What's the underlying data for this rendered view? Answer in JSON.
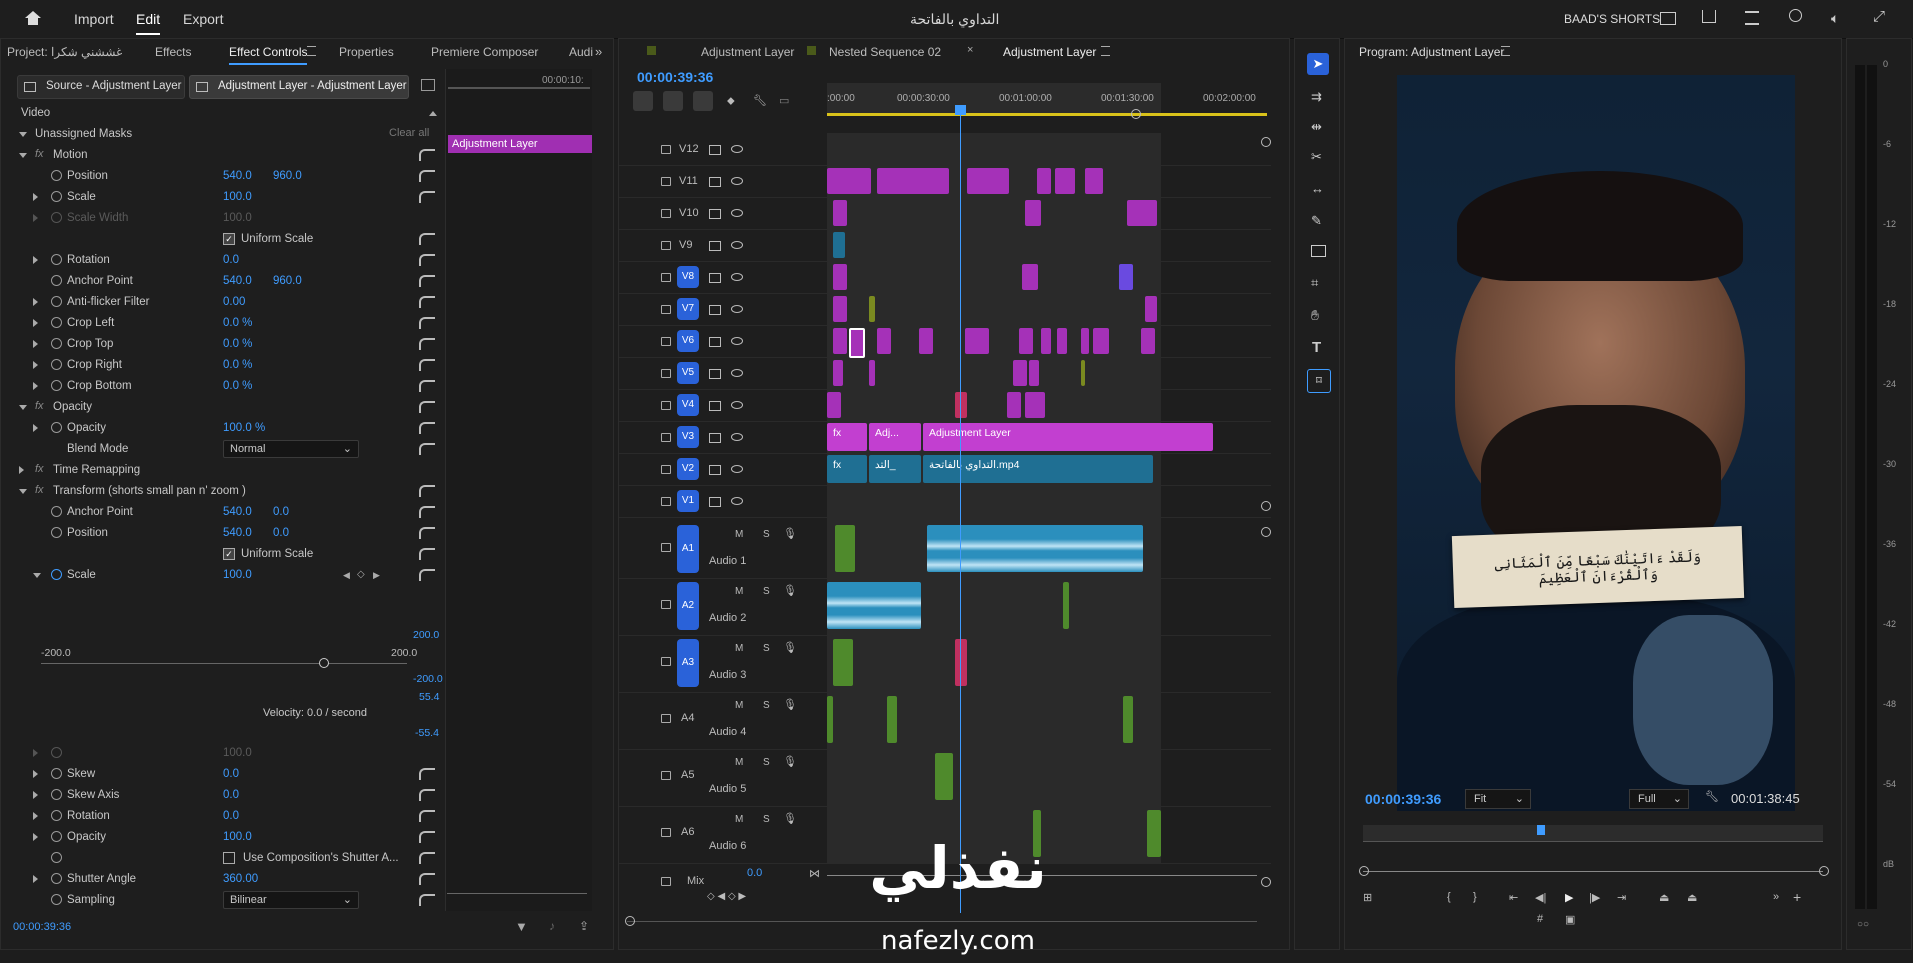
{
  "topbar": {
    "home": "home-icon",
    "menu": [
      "Import",
      "Edit",
      "Export"
    ],
    "title": "التداوي بالفاتحة",
    "workspace": "BAAD'S SHORTS"
  },
  "effect_controls": {
    "tabs": [
      "Project: غششني شكرا",
      "Effects",
      "Effect Controls",
      "Properties",
      "Premiere Composer",
      "Audi"
    ],
    "source": "Source - Adjustment Layer",
    "target": "Adjustment Layer - Adjustment Layer",
    "mini_time": "00:00:10:",
    "mini_clip": "Adjustment Layer",
    "section": "Video",
    "clear_all": "Clear all",
    "unassigned": "Unassigned Masks",
    "rows": {
      "motion": "Motion",
      "position": {
        "label": "Position",
        "v1": "540.0",
        "v2": "960.0"
      },
      "scale": {
        "label": "Scale",
        "v": "100.0"
      },
      "scale_width": {
        "label": "Scale Width",
        "v": "100.0"
      },
      "uniform": "Uniform Scale",
      "rotation": {
        "label": "Rotation",
        "v": "0.0"
      },
      "anchor": {
        "label": "Anchor Point",
        "v1": "540.0",
        "v2": "960.0"
      },
      "antiflicker": {
        "label": "Anti-flicker Filter",
        "v": "0.00"
      },
      "crop_left": {
        "label": "Crop Left",
        "v": "0.0 %"
      },
      "crop_top": {
        "label": "Crop Top",
        "v": "0.0 %"
      },
      "crop_right": {
        "label": "Crop Right",
        "v": "0.0 %"
      },
      "crop_bottom": {
        "label": "Crop Bottom",
        "v": "0.0 %"
      },
      "opacity_group": "Opacity",
      "opacity": {
        "label": "Opacity",
        "v": "100.0 %"
      },
      "blend": {
        "label": "Blend Mode",
        "v": "Normal"
      },
      "time_remap": "Time Remapping",
      "transform": "Transform (shorts small pan n' zoom )",
      "t_anchor": {
        "label": "Anchor Point",
        "v1": "540.0",
        "v2": "0.0"
      },
      "t_position": {
        "label": "Position",
        "v1": "540.0",
        "v2": "0.0"
      },
      "t_uniform": "Uniform Scale",
      "t_scale": {
        "label": "Scale",
        "v": "100.0"
      },
      "graph_top": "200.0",
      "graph_min": "-200.0",
      "graph_max": "200.0",
      "graph_bottom": "-200.0",
      "vel_top": "55.4",
      "vel_bottom": "-55.4",
      "velocity": "Velocity: 0.0 / second",
      "t_dim": "100.0",
      "skew": {
        "label": "Skew",
        "v": "0.0"
      },
      "skew_axis": {
        "label": "Skew Axis",
        "v": "0.0"
      },
      "t_rotation": {
        "label": "Rotation",
        "v": "0.0"
      },
      "t_opacity": {
        "label": "Opacity",
        "v": "100.0"
      },
      "shutter_comp": "Use Composition's Shutter A...",
      "shutter_angle": {
        "label": "Shutter Angle",
        "v": "360.00"
      },
      "sampling": {
        "label": "Sampling",
        "v": "Bilinear"
      }
    },
    "timecode": "00:00:39:36"
  },
  "timeline": {
    "tabs": [
      "Adjustment Layer",
      "Nested Sequence 02",
      "Adjustment Layer"
    ],
    "timecode": "00:00:39:36",
    "ruler": [
      ":00:00",
      "00:00:30:00",
      "00:01:00:00",
      "00:01:30:00",
      "00:02:00:00"
    ],
    "video_tracks": [
      "V12",
      "V11",
      "V10",
      "V9",
      "V8",
      "V7",
      "V6",
      "V5",
      "V4",
      "V3",
      "V2",
      "V1"
    ],
    "audio_tracks": [
      {
        "id": "A1",
        "name": "Audio 1"
      },
      {
        "id": "A2",
        "name": "Audio 2"
      },
      {
        "id": "A3",
        "name": "Audio 3"
      },
      {
        "id": "A4",
        "name": "Audio 4"
      },
      {
        "id": "A5",
        "name": "Audio 5"
      },
      {
        "id": "A6",
        "name": "Audio 6"
      }
    ],
    "clip_labels": {
      "adj_short": "Adj...",
      "adj_long": "Adjustment Layer",
      "v2_a": "التد_",
      "v2_b": "التداوي بالفاتحة.mp4",
      "fx": "fx"
    },
    "mix": "Mix",
    "mix_val": "0.0",
    "track_buttons": {
      "m": "M",
      "s": "S"
    }
  },
  "program": {
    "title": "Program: Adjustment Layer",
    "timecode": "00:00:39:36",
    "fit": "Fit",
    "quality": "Full",
    "duration": "00:01:38:45",
    "caption": "وَلَقَدْ ءَاتَيْنَٰكَ سَبْعًا مِّنَ ٱلْمَثَانِى وَٱلْقُرْءَانَ ٱلْعَظِيمَ"
  },
  "meter": {
    "ticks": [
      "0",
      "-6",
      "-12",
      "-18",
      "-24",
      "-30",
      "-36",
      "-42",
      "-48",
      "-54",
      "dB"
    ]
  },
  "watermark": {
    "arabic": "نفذلي",
    "latin": "nafezly.com"
  },
  "colors": {
    "accent": "#2a62d9",
    "clip_pink": "#c23fd0",
    "clip_teal": "#1f6f93",
    "audio_clip": "#2b8fbd",
    "audio_green": "#4f8a2c"
  }
}
